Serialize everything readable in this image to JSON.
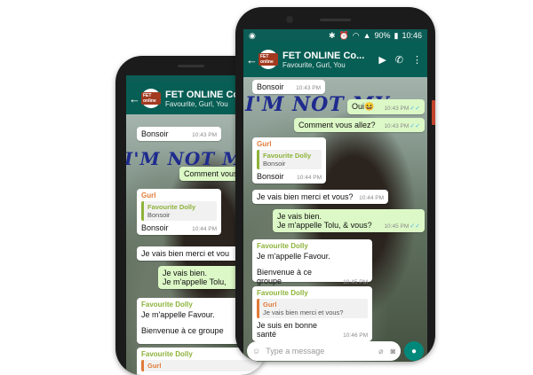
{
  "header": {
    "title": "FET ONLINE Co...",
    "title_back": "FET ONLINE Co",
    "subtitle": "Favourite, Gurl, You",
    "logo_text": "FET online"
  },
  "status": {
    "battery": "90%",
    "time": "10:46"
  },
  "handwriting": "I'M NOT MY",
  "front_messages": [
    {
      "text": "Bonsoir",
      "time": "10:43 PM"
    },
    {
      "text": "Oui😆",
      "time": "10:43 PM"
    },
    {
      "text": "Comment vous allez?",
      "time": "10:43 PM"
    },
    {
      "sender": "Gurl",
      "quote_name": "Favourite Dolly",
      "quote_text": "Bonsoir",
      "text": "Bonsoir",
      "time": "10:44 PM"
    },
    {
      "text": "Je vais bien merci et vous?",
      "time": "10:44 PM"
    },
    {
      "text": "Je vais bien.",
      "text2": "Je m'appelle Tolu, & vous?",
      "time": "10:45 PM"
    },
    {
      "sender": "Favourite Dolly",
      "text": "Je m'appelle Favour.",
      "text2": "Bienvenue à ce groupe",
      "time": "10:45 PM"
    },
    {
      "sender": "Favourite Dolly",
      "quote_name": "Gurl",
      "quote_text": "Je vais bien merci et vous?",
      "text": "Je suis en bonne santé",
      "time": "10:46 PM"
    }
  ],
  "back_messages": [
    {
      "text": "Bonsoir",
      "time": "10:43 PM"
    },
    {
      "text": "Comment vous"
    },
    {
      "sender": "Gurl",
      "quote_name": "Favourite Dolly",
      "quote_text": "Bonsoir",
      "text": "Bonsoir",
      "time": "10:44 PM"
    },
    {
      "text": "Je vais bien merci et vou"
    },
    {
      "text": "Je vais bien.",
      "text2": "Je m'appelle Tolu,"
    },
    {
      "sender": "Favourite Dolly",
      "text": "Je m'appelle Favour.",
      "text2": "Bienvenue à ce groupe"
    },
    {
      "sender": "Favourite Dolly",
      "quote_name": "Gurl"
    }
  ],
  "input": {
    "placeholder": "Type a message"
  },
  "colors": {
    "appbar": "#075e54",
    "outgoing": "#dcf8c6",
    "incoming": "#ffffff",
    "accent": "#00897b"
  },
  "icons": [
    "back-arrow-icon",
    "video-call-icon",
    "phone-icon",
    "more-icon",
    "emoji-icon",
    "attach-icon",
    "camera-icon",
    "mic-icon",
    "double-check-icon"
  ]
}
